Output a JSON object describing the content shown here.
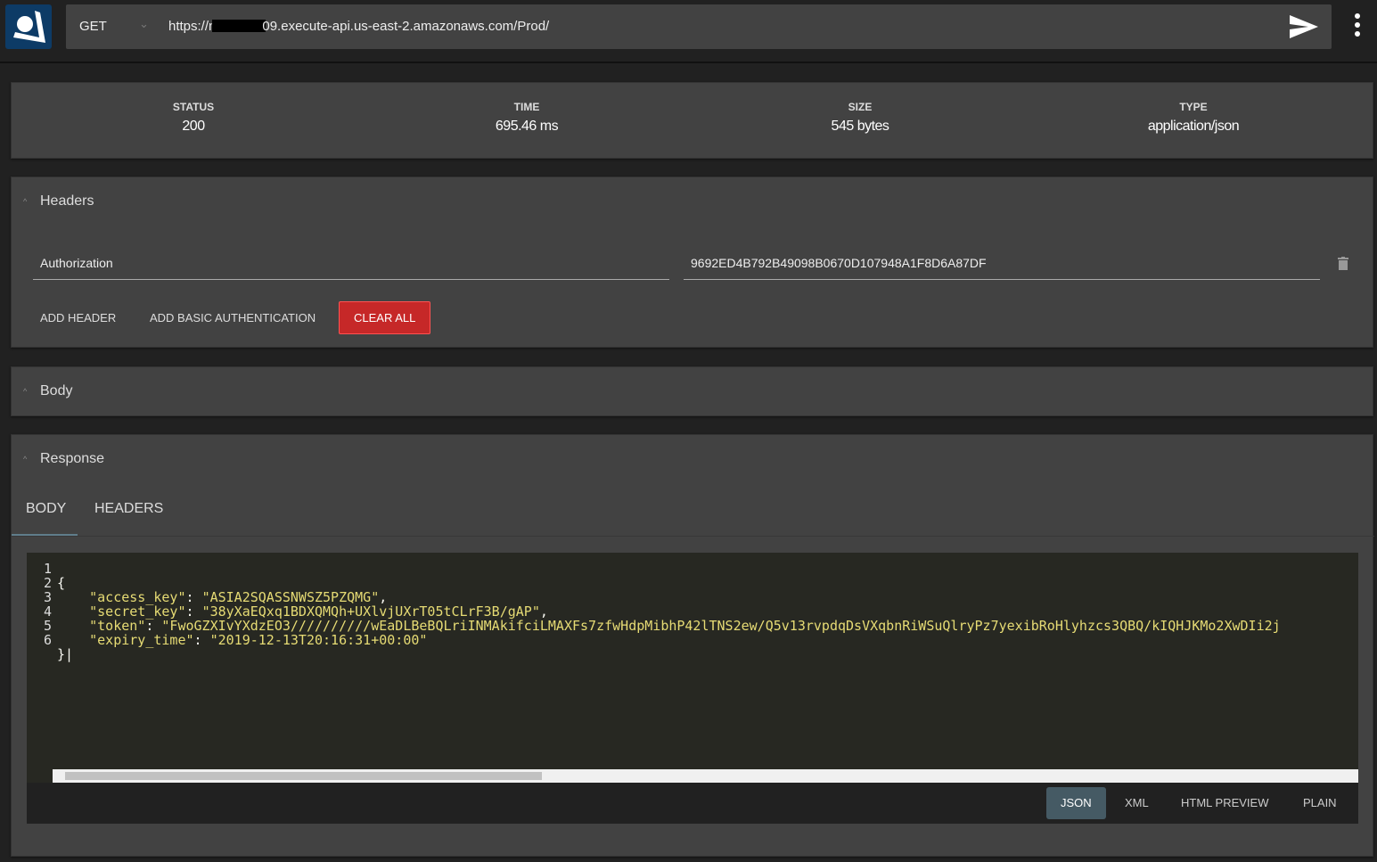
{
  "request": {
    "method": "GET",
    "url_prefix": "https://n",
    "url_suffix": "09.execute-api.us-east-2.amazonaws.com/Prod/"
  },
  "stats": [
    {
      "label": "STATUS",
      "value": "200"
    },
    {
      "label": "TIME",
      "value": "695.46 ms"
    },
    {
      "label": "SIZE",
      "value": "545 bytes"
    },
    {
      "label": "TYPE",
      "value": "application/json"
    }
  ],
  "headers": {
    "title": "Headers",
    "key": "Authorization",
    "value": "9692ED4B792B49098B0670D107948A1F8D6A87DF",
    "add_header": "ADD HEADER",
    "add_basic": "ADD BASIC AUTHENTICATION",
    "clear_all": "CLEAR ALL"
  },
  "body": {
    "title": "Body"
  },
  "response": {
    "title": "Response",
    "tabs": [
      "BODY",
      "HEADERS"
    ],
    "lines": [
      "1",
      "2",
      "3",
      "4",
      "5",
      "6"
    ],
    "code": {
      "l1": "{",
      "k2": "\"access_key\"",
      "v2": "\"ASIA2SQASSNWSZ5PZQMG\"",
      "k3": "\"secret_key\"",
      "v3": "\"38yXaEQxq1BDXQMQh+UXlvjUXrT05tCLrF3B/gAP\"",
      "k4": "\"token\"",
      "v4": "\"FwoGZXIvYXdzEO3//////////wEaDLBeBQLriINMAkifciLMAXFs7zfwHdpMibhP42lTNS2ew/Q5v13rvpdqDsVXqbnRiWSuQlryPz7yexibRoHlyhzcs3QBQ/kIQHJKMo2XwDIi2j",
      "k5": "\"expiry_time\"",
      "v5": "\"2019-12-13T20:16:31+00:00\"",
      "l6": "}"
    },
    "formats": [
      "JSON",
      "XML",
      "HTML PREVIEW",
      "PLAIN"
    ],
    "active_format": "JSON"
  },
  "colors": {
    "accent": "#455a64",
    "danger": "#c62828",
    "string": "#e6db74"
  }
}
